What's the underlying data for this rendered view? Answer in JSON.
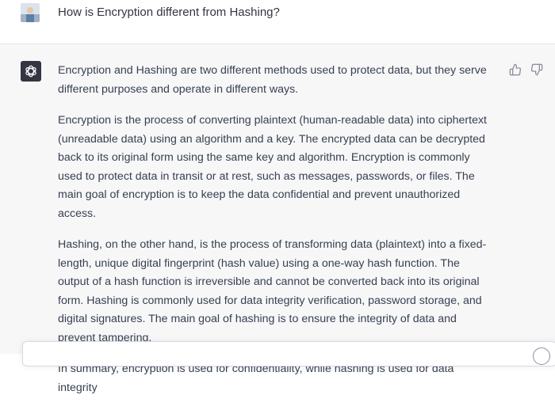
{
  "user": {
    "question": "How is Encryption different from Hashing?"
  },
  "assistant": {
    "paragraphs": [
      "Encryption and Hashing are two different methods used to protect data, but they serve different purposes and operate in different ways.",
      "Encryption is the process of converting plaintext (human-readable data) into ciphertext (unreadable data) using an algorithm and a key. The encrypted data can be decrypted back to its original form using the same key and algorithm. Encryption is commonly used to protect data in transit or at rest, such as messages, passwords, or files. The main goal of encryption is to keep the data confidential and prevent unauthorized access.",
      "Hashing, on the other hand, is the process of transforming data (plaintext) into a fixed-length, unique digital fingerprint (hash value) using a one-way hash function. The output of a hash function is irreversible and cannot be converted back into its original form. Hashing is commonly used for data integrity verification, password storage, and digital signatures. The main goal of hashing is to ensure the integrity of data and prevent tampering.",
      "In summary, encryption is used for confidentiality, while hashing is used for data integrity"
    ]
  },
  "icons": {
    "user_avatar": "user-avatar",
    "assistant_avatar": "openai-logo-icon",
    "thumbs_up": "thumbs-up-icon",
    "thumbs_down": "thumbs-down-icon"
  },
  "colors": {
    "assistant_background": "#f7f7f8",
    "assistant_avatar_background": "#343541",
    "text": "#374151"
  }
}
